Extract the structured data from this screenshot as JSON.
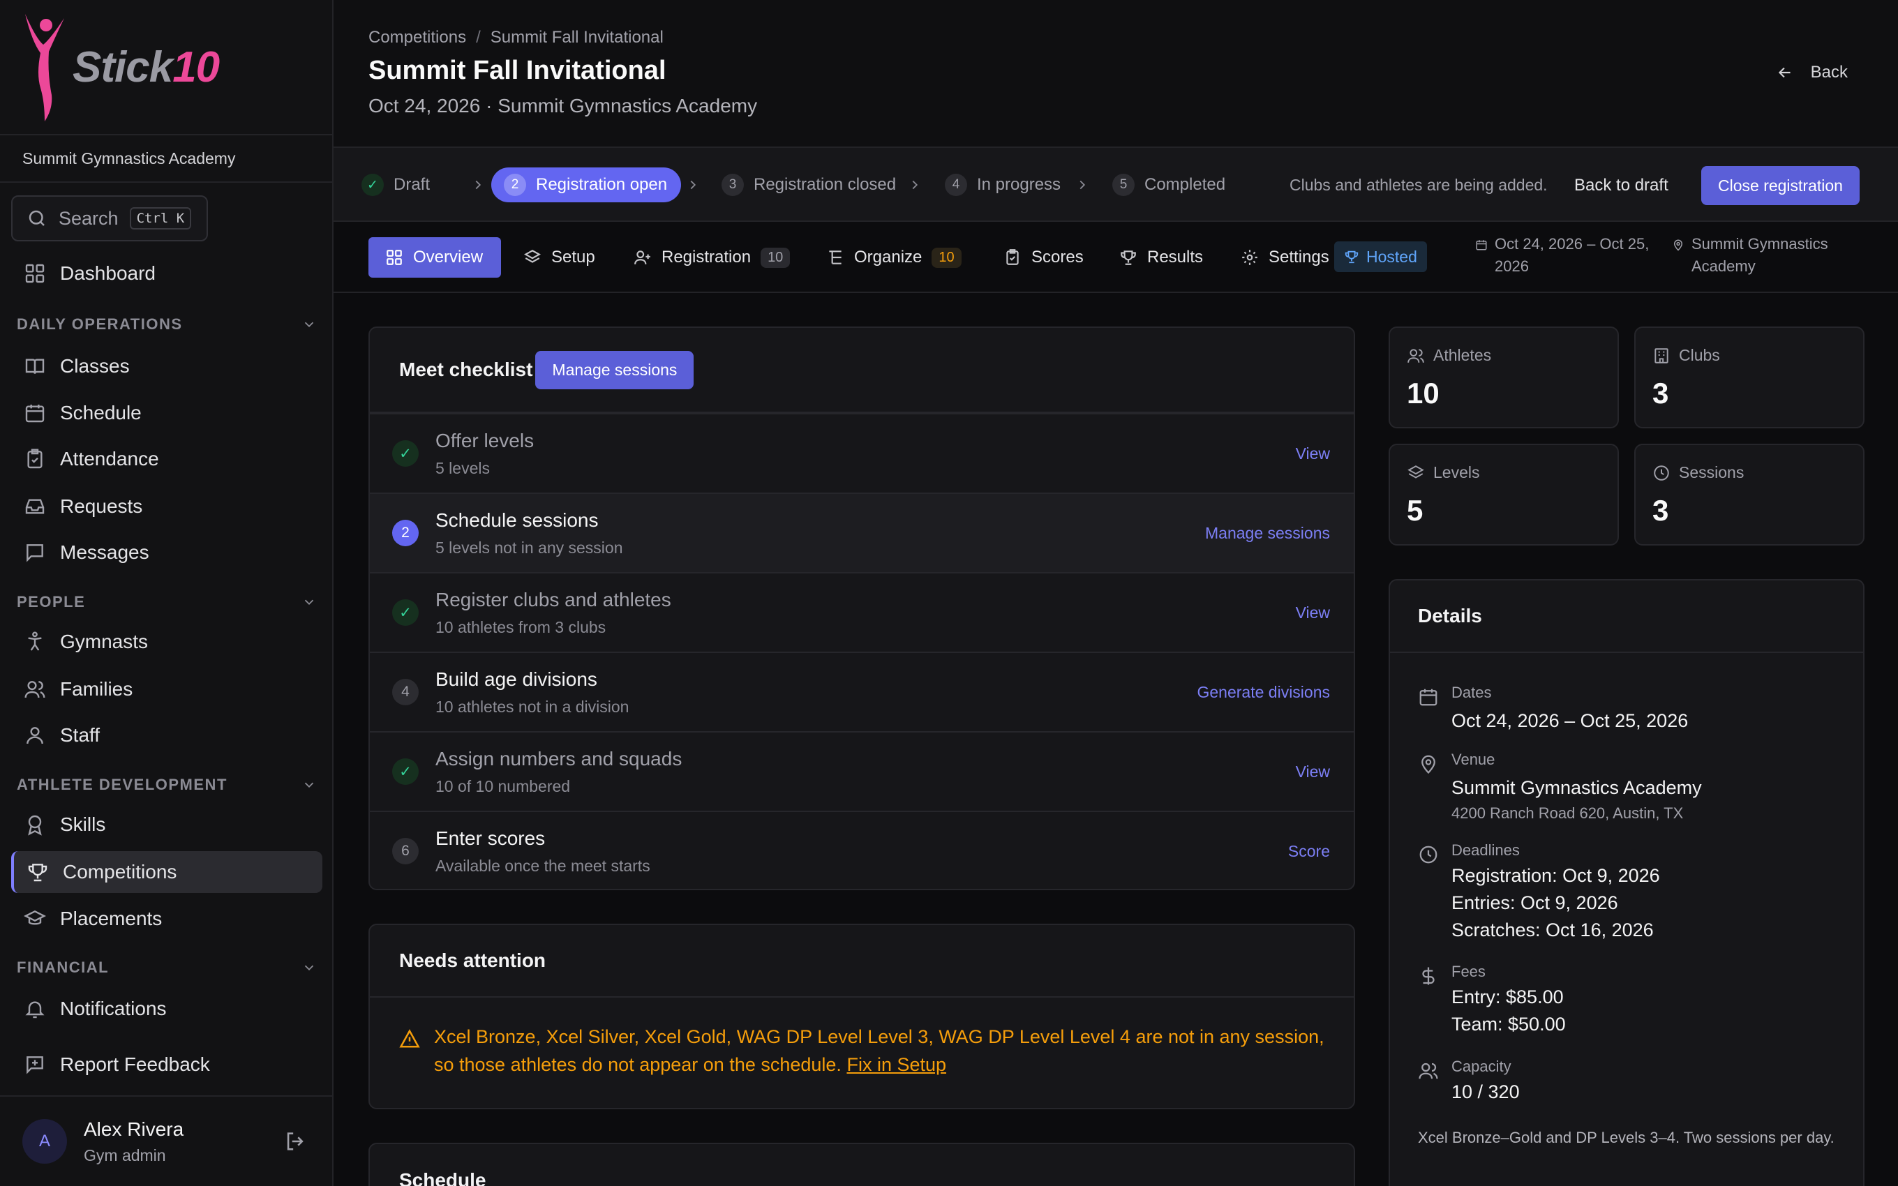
{
  "app": {
    "brand_prefix": "Stick",
    "brand_suffix": "10",
    "org_name": "Summit Gymnastics Academy"
  },
  "search": {
    "label": "Search",
    "shortcut": "Ctrl K"
  },
  "nav": {
    "dashboard": "Dashboard",
    "sections": {
      "daily": "DAILY OPERATIONS",
      "people": "PEOPLE",
      "athlete": "ATHLETE DEVELOPMENT",
      "financial": "FINANCIAL"
    },
    "items": {
      "classes": "Classes",
      "schedule": "Schedule",
      "attendance": "Attendance",
      "requests": "Requests",
      "messages": "Messages",
      "gymnasts": "Gymnasts",
      "families": "Families",
      "staff": "Staff",
      "skills": "Skills",
      "competitions": "Competitions",
      "placements": "Placements",
      "notifications": "Notifications",
      "feedback": "Report Feedback"
    }
  },
  "user": {
    "initial": "A",
    "name": "Alex Rivera",
    "role": "Gym admin"
  },
  "page": {
    "breadcrumb_root": "Competitions",
    "breadcrumb_sep": "/",
    "breadcrumb_current": "Summit Fall Invitational",
    "title": "Summit Fall Invitational",
    "subtitle": "Oct 24, 2026 · Summit Gymnastics Academy",
    "back_label": "Back"
  },
  "stepper": {
    "steps": [
      {
        "num": "✓",
        "label": "Draft"
      },
      {
        "num": "2",
        "label": "Registration open"
      },
      {
        "num": "3",
        "label": "Registration closed"
      },
      {
        "num": "4",
        "label": "In progress"
      },
      {
        "num": "5",
        "label": "Completed"
      }
    ],
    "note": "Clubs and athletes are being added.",
    "back_to_draft": "Back to draft",
    "close_registration": "Close registration"
  },
  "tabs": {
    "overview": "Overview",
    "setup": "Setup",
    "registration": "Registration",
    "registration_count": "10",
    "organize": "Organize",
    "organize_count": "10",
    "scores": "Scores",
    "results": "Results",
    "settings": "Settings",
    "hosted": "Hosted",
    "dates": "Oct 24, 2026 – Oct 25, 2026",
    "venue": "Summit Gymnastics Academy"
  },
  "checklist": {
    "title": "Meet checklist",
    "button": "Manage sessions",
    "items": [
      {
        "mark": "✓",
        "title": "Offer levels",
        "sub": "5 levels",
        "action": "View"
      },
      {
        "mark": "2",
        "title": "Schedule sessions",
        "sub": "5 levels not in any session",
        "action": "Manage sessions"
      },
      {
        "mark": "✓",
        "title": "Register clubs and athletes",
        "sub": "10 athletes from 3 clubs",
        "action": "View"
      },
      {
        "mark": "4",
        "title": "Build age divisions",
        "sub": "10 athletes not in a division",
        "action": "Generate divisions"
      },
      {
        "mark": "✓",
        "title": "Assign numbers and squads",
        "sub": "10 of 10 numbered",
        "action": "View"
      },
      {
        "mark": "6",
        "title": "Enter scores",
        "sub": "Available once the meet starts",
        "action": "Score"
      }
    ]
  },
  "attention": {
    "title": "Needs attention",
    "message": "Xcel Bronze, Xcel Silver, Xcel Gold, WAG DP Level Level 3, WAG DP Level Level 4 are not in any session, so those athletes do not appear on the schedule.",
    "link": "Fix in Setup"
  },
  "schedule": {
    "title": "Schedule"
  },
  "stats": {
    "athletes_label": "Athletes",
    "athletes": "10",
    "clubs_label": "Clubs",
    "clubs": "3",
    "levels_label": "Levels",
    "levels": "5",
    "sessions_label": "Sessions",
    "sessions": "3"
  },
  "details": {
    "title": "Details",
    "dates_label": "Dates",
    "dates": "Oct 24, 2026 – Oct 25, 2026",
    "venue_label": "Venue",
    "venue": "Summit Gymnastics Academy",
    "address": "4200 Ranch Road 620, Austin, TX",
    "deadlines_label": "Deadlines",
    "deadline_registration": "Registration: Oct 9, 2026",
    "deadline_entries": "Entries: Oct 9, 2026",
    "deadline_scratches": "Scratches: Oct 16, 2026",
    "fees_label": "Fees",
    "fee_entry": "Entry: $85.00",
    "fee_team": "Team: $50.00",
    "capacity_label": "Capacity",
    "capacity": "10 / 320",
    "notes": "Xcel Bronze–Gold and DP Levels 3–4. Two sessions per day."
  },
  "colors": {
    "accent": "#5b5fd8",
    "brand_pink": "#ec4899",
    "warning": "#f59e0b",
    "success": "#34d399"
  }
}
